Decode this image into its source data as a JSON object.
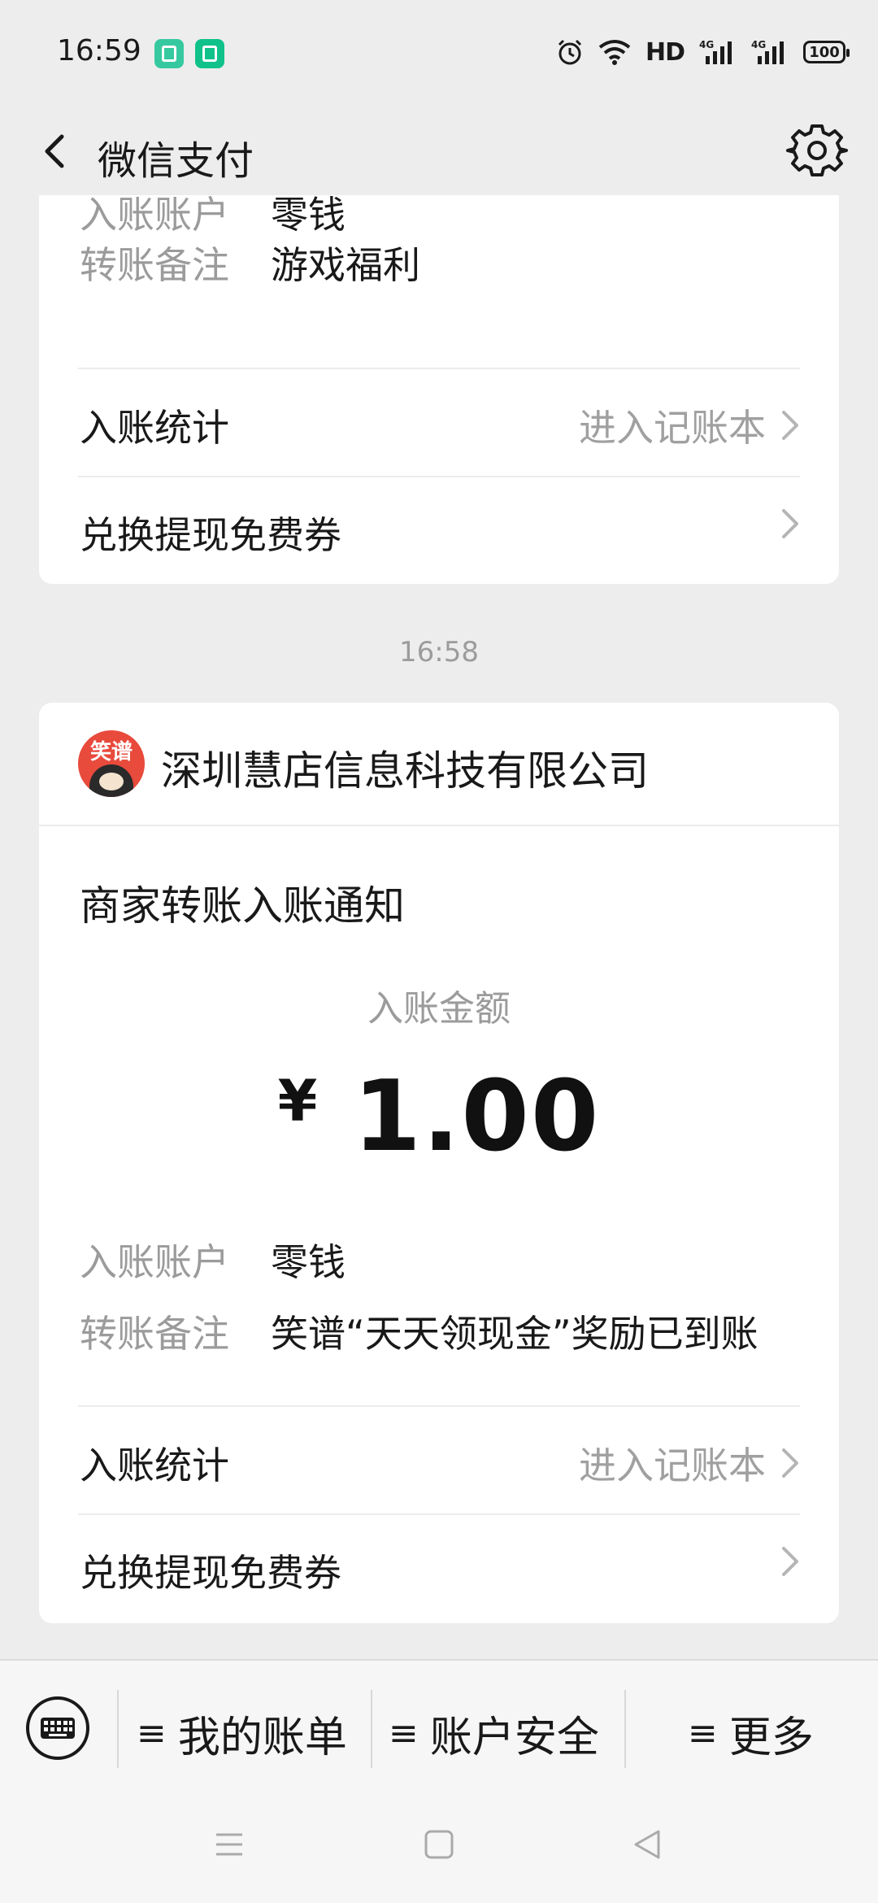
{
  "status_bar": {
    "time": "16:59",
    "network": "HD",
    "battery": "100"
  },
  "nav": {
    "title": "微信支付",
    "back_icon": "back-chevron-icon",
    "settings_icon": "gear-icon"
  },
  "card_top": {
    "account_label": "入账账户",
    "account_value": "零钱",
    "note_label": "转账备注",
    "note_value": "游戏福利",
    "stats_label": "入账统计",
    "stats_hint": "进入记账本",
    "coupon_label": "兑换提现免费券"
  },
  "time_separator": "16:58",
  "card_main": {
    "merchant_name": "深圳慧店信息科技有限公司",
    "merchant_logo_text": "笑谱",
    "notice_title": "商家转账入账通知",
    "amount_label": "入账金额",
    "currency": "¥",
    "amount": "1.00",
    "account_label": "入账账户",
    "account_value": "零钱",
    "note_label": "转账备注",
    "note_value": "笑谱“天天领现金”奖励已到账",
    "stats_label": "入账统计",
    "stats_hint": "进入记账本",
    "coupon_label": "兑换提现免费券"
  },
  "bottom_menu": {
    "items": [
      {
        "label": "我的账单"
      },
      {
        "label": "账户安全"
      },
      {
        "label": "更多"
      }
    ],
    "hamburger": "≡"
  }
}
